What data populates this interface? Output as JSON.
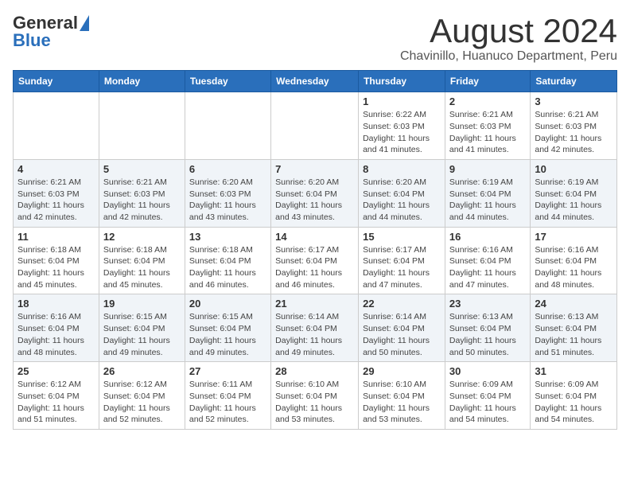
{
  "header": {
    "logo_general": "General",
    "logo_blue": "Blue",
    "month_title": "August 2024",
    "location": "Chavinillo, Huanuco Department, Peru"
  },
  "days_of_week": [
    "Sunday",
    "Monday",
    "Tuesday",
    "Wednesday",
    "Thursday",
    "Friday",
    "Saturday"
  ],
  "weeks": [
    [
      {
        "day": "",
        "sunrise": "",
        "sunset": "",
        "daylight": ""
      },
      {
        "day": "",
        "sunrise": "",
        "sunset": "",
        "daylight": ""
      },
      {
        "day": "",
        "sunrise": "",
        "sunset": "",
        "daylight": ""
      },
      {
        "day": "",
        "sunrise": "",
        "sunset": "",
        "daylight": ""
      },
      {
        "day": "1",
        "sunrise": "6:22 AM",
        "sunset": "6:03 PM",
        "daylight": "11 hours and 41 minutes."
      },
      {
        "day": "2",
        "sunrise": "6:21 AM",
        "sunset": "6:03 PM",
        "daylight": "11 hours and 41 minutes."
      },
      {
        "day": "3",
        "sunrise": "6:21 AM",
        "sunset": "6:03 PM",
        "daylight": "11 hours and 42 minutes."
      }
    ],
    [
      {
        "day": "4",
        "sunrise": "6:21 AM",
        "sunset": "6:03 PM",
        "daylight": "11 hours and 42 minutes."
      },
      {
        "day": "5",
        "sunrise": "6:21 AM",
        "sunset": "6:03 PM",
        "daylight": "11 hours and 42 minutes."
      },
      {
        "day": "6",
        "sunrise": "6:20 AM",
        "sunset": "6:03 PM",
        "daylight": "11 hours and 43 minutes."
      },
      {
        "day": "7",
        "sunrise": "6:20 AM",
        "sunset": "6:04 PM",
        "daylight": "11 hours and 43 minutes."
      },
      {
        "day": "8",
        "sunrise": "6:20 AM",
        "sunset": "6:04 PM",
        "daylight": "11 hours and 44 minutes."
      },
      {
        "day": "9",
        "sunrise": "6:19 AM",
        "sunset": "6:04 PM",
        "daylight": "11 hours and 44 minutes."
      },
      {
        "day": "10",
        "sunrise": "6:19 AM",
        "sunset": "6:04 PM",
        "daylight": "11 hours and 44 minutes."
      }
    ],
    [
      {
        "day": "11",
        "sunrise": "6:18 AM",
        "sunset": "6:04 PM",
        "daylight": "11 hours and 45 minutes."
      },
      {
        "day": "12",
        "sunrise": "6:18 AM",
        "sunset": "6:04 PM",
        "daylight": "11 hours and 45 minutes."
      },
      {
        "day": "13",
        "sunrise": "6:18 AM",
        "sunset": "6:04 PM",
        "daylight": "11 hours and 46 minutes."
      },
      {
        "day": "14",
        "sunrise": "6:17 AM",
        "sunset": "6:04 PM",
        "daylight": "11 hours and 46 minutes."
      },
      {
        "day": "15",
        "sunrise": "6:17 AM",
        "sunset": "6:04 PM",
        "daylight": "11 hours and 47 minutes."
      },
      {
        "day": "16",
        "sunrise": "6:16 AM",
        "sunset": "6:04 PM",
        "daylight": "11 hours and 47 minutes."
      },
      {
        "day": "17",
        "sunrise": "6:16 AM",
        "sunset": "6:04 PM",
        "daylight": "11 hours and 48 minutes."
      }
    ],
    [
      {
        "day": "18",
        "sunrise": "6:16 AM",
        "sunset": "6:04 PM",
        "daylight": "11 hours and 48 minutes."
      },
      {
        "day": "19",
        "sunrise": "6:15 AM",
        "sunset": "6:04 PM",
        "daylight": "11 hours and 49 minutes."
      },
      {
        "day": "20",
        "sunrise": "6:15 AM",
        "sunset": "6:04 PM",
        "daylight": "11 hours and 49 minutes."
      },
      {
        "day": "21",
        "sunrise": "6:14 AM",
        "sunset": "6:04 PM",
        "daylight": "11 hours and 49 minutes."
      },
      {
        "day": "22",
        "sunrise": "6:14 AM",
        "sunset": "6:04 PM",
        "daylight": "11 hours and 50 minutes."
      },
      {
        "day": "23",
        "sunrise": "6:13 AM",
        "sunset": "6:04 PM",
        "daylight": "11 hours and 50 minutes."
      },
      {
        "day": "24",
        "sunrise": "6:13 AM",
        "sunset": "6:04 PM",
        "daylight": "11 hours and 51 minutes."
      }
    ],
    [
      {
        "day": "25",
        "sunrise": "6:12 AM",
        "sunset": "6:04 PM",
        "daylight": "11 hours and 51 minutes."
      },
      {
        "day": "26",
        "sunrise": "6:12 AM",
        "sunset": "6:04 PM",
        "daylight": "11 hours and 52 minutes."
      },
      {
        "day": "27",
        "sunrise": "6:11 AM",
        "sunset": "6:04 PM",
        "daylight": "11 hours and 52 minutes."
      },
      {
        "day": "28",
        "sunrise": "6:10 AM",
        "sunset": "6:04 PM",
        "daylight": "11 hours and 53 minutes."
      },
      {
        "day": "29",
        "sunrise": "6:10 AM",
        "sunset": "6:04 PM",
        "daylight": "11 hours and 53 minutes."
      },
      {
        "day": "30",
        "sunrise": "6:09 AM",
        "sunset": "6:04 PM",
        "daylight": "11 hours and 54 minutes."
      },
      {
        "day": "31",
        "sunrise": "6:09 AM",
        "sunset": "6:04 PM",
        "daylight": "11 hours and 54 minutes."
      }
    ]
  ]
}
